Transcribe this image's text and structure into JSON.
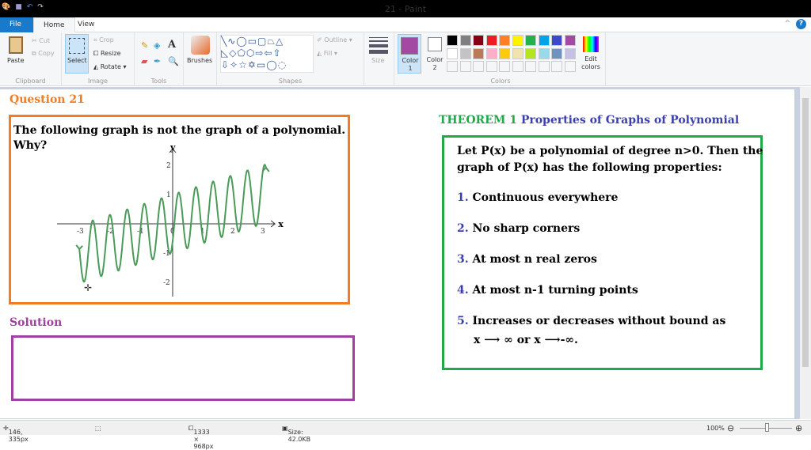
{
  "window": {
    "title": "21 - Paint"
  },
  "tabs": [
    "File",
    "Home",
    "View"
  ],
  "ribbon": {
    "clipboard": {
      "label": "Clipboard",
      "paste": "Paste",
      "cut": "Cut",
      "copy": "Copy"
    },
    "image": {
      "label": "Image",
      "select": "Select",
      "crop": "Crop",
      "resize": "Resize",
      "rotate": "Rotate"
    },
    "tools": {
      "label": "Tools"
    },
    "brushes": "Brushes",
    "shapes": {
      "label": "Shapes",
      "outline": "Outline",
      "fill": "Fill"
    },
    "size": "Size",
    "color1": "Color 1",
    "color2": "Color 2",
    "colors": {
      "label": "Colors",
      "edit": "Edit colors",
      "row1": [
        "#000000",
        "#7f7f7f",
        "#880015",
        "#ed1c24",
        "#ff7f27",
        "#fff200",
        "#22b14c",
        "#00a2e8",
        "#3f48cc",
        "#a349a4"
      ],
      "row2": [
        "#ffffff",
        "#c3c3c3",
        "#b97a57",
        "#ffaec9",
        "#ffc90e",
        "#efe4b0",
        "#b5e61d",
        "#99d9ea",
        "#7092be",
        "#c8bfe7"
      ],
      "color1_value": "#a349a4"
    }
  },
  "doc": {
    "question": "Question  21",
    "prompt_line1": "The following graph is not the graph of a polynomial.",
    "prompt_line2": "Why?",
    "solution": "Solution",
    "theorem_label": "THEOREM 1",
    "theorem_title": "Properties of Graphs of Polynomial",
    "intro1": "Let P(x) be a polynomial of degree n>0. Then the",
    "intro2": "graph of P(x) has the following properties:",
    "props": [
      {
        "n": "1.",
        "t": "Continuous everywhere"
      },
      {
        "n": "2.",
        "t": "No sharp corners"
      },
      {
        "n": "3.",
        "t": "At most n real zeros"
      },
      {
        "n": "4.",
        "t": "At most n-1 turning points"
      },
      {
        "n": "5.",
        "t": "Increases or decreases without bound as"
      }
    ],
    "limit_line": "x ⟶  ∞  or  x ⟶-∞."
  },
  "chart_data": {
    "type": "line",
    "xlabel": "x",
    "ylabel": "y",
    "xticks": [
      "-3",
      "-2",
      "-1",
      "0",
      "1",
      "2",
      "3"
    ],
    "yticks": [
      "2",
      "1",
      "-1",
      "-2"
    ],
    "xlim": [
      -3.6,
      3.6
    ],
    "ylim": [
      -2.4,
      2.4
    ],
    "function": "y ≈ x/3 + cos(11(x-0.2))",
    "domain": [
      -3.1,
      3.1
    ],
    "color": "#4a9a5a"
  },
  "status": {
    "cursor": "146, 335px",
    "dimensions": "1333 × 968px",
    "size": "Size: 42.0KB",
    "zoom": "100%"
  }
}
